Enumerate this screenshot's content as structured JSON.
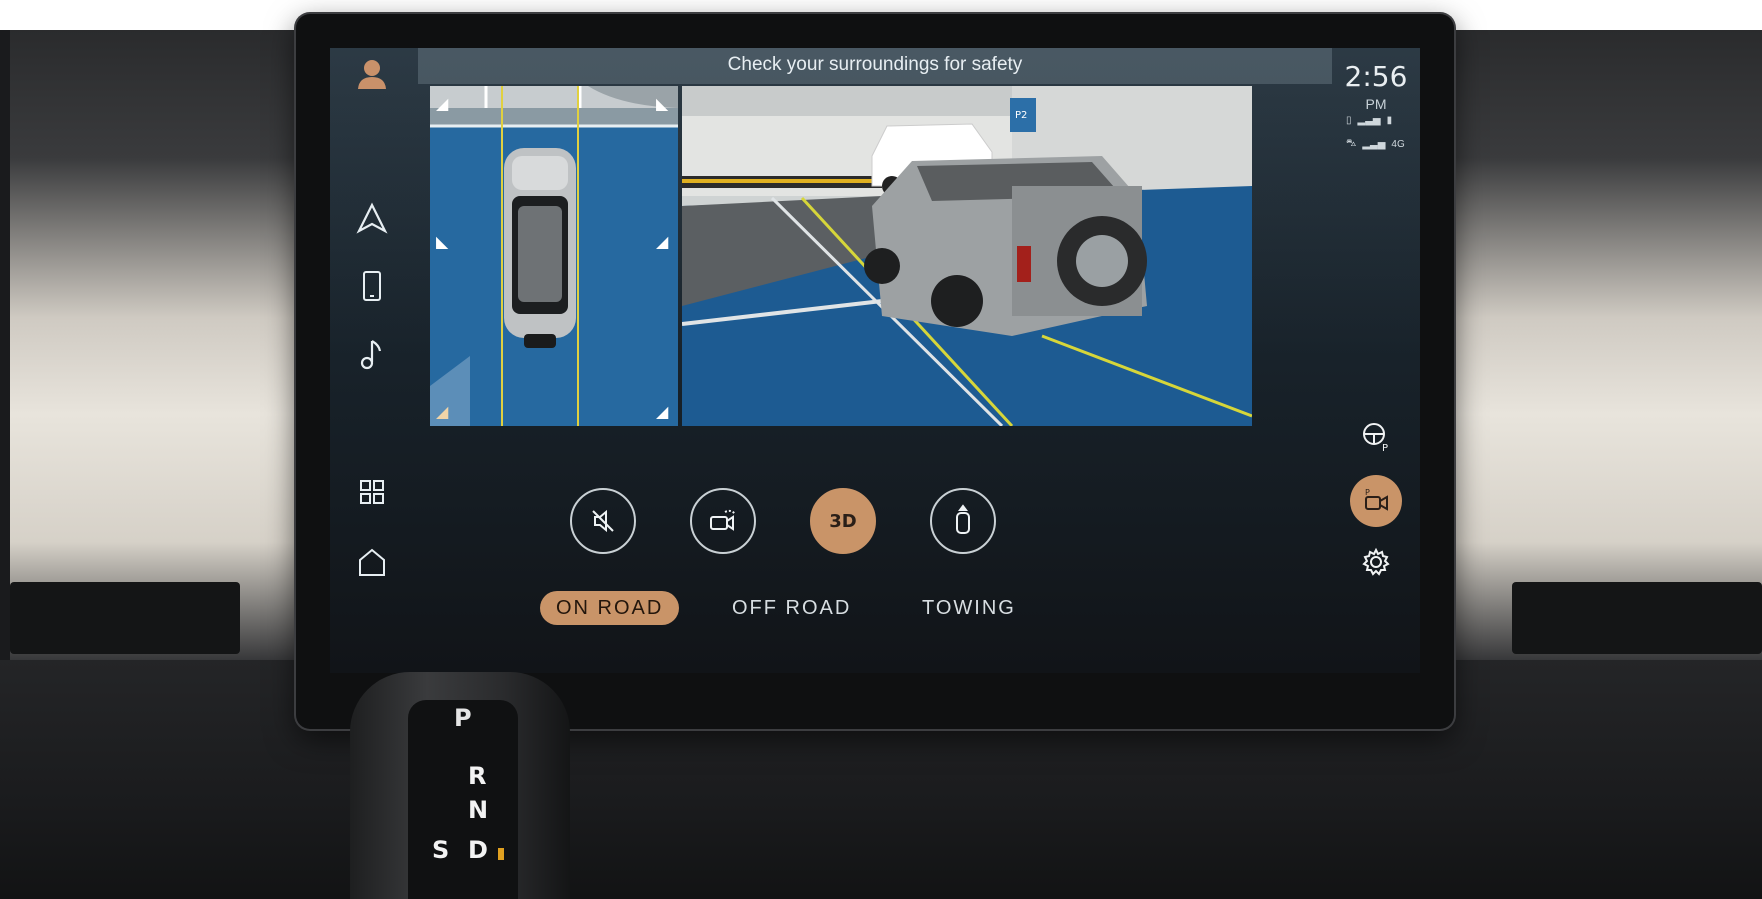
{
  "banner": {
    "text": "Check your surroundings for safety"
  },
  "status": {
    "time": "2:56",
    "ampm": "PM",
    "network": "4G"
  },
  "left_rail": {
    "items": [
      {
        "icon": "user-profile-icon"
      },
      {
        "icon": "navigation-icon"
      },
      {
        "icon": "phone-icon"
      },
      {
        "icon": "music-icon"
      },
      {
        "icon": "apps-grid-icon"
      },
      {
        "icon": "home-icon"
      }
    ]
  },
  "right_rail": {
    "items": [
      {
        "icon": "steering-wheel-parking-icon",
        "active": false
      },
      {
        "icon": "parking-camera-icon",
        "active": true
      },
      {
        "icon": "settings-gear-icon",
        "active": false
      }
    ]
  },
  "camera_controls": [
    {
      "icon": "mute-sensor-audio-icon",
      "label": "",
      "active": false
    },
    {
      "icon": "camera-rotate-view-icon",
      "label": "",
      "active": false
    },
    {
      "icon": "3d-view-icon",
      "label": "3D",
      "active": true
    },
    {
      "icon": "top-view-car-icon",
      "label": "",
      "active": false
    }
  ],
  "modes": [
    {
      "label": "ON ROAD",
      "active": true
    },
    {
      "label": "OFF ROAD",
      "active": false
    },
    {
      "label": "TOWING",
      "active": false
    }
  ],
  "parking_sign": "P2",
  "gear_selector": {
    "park": "P",
    "reverse": "R",
    "neutral": "N",
    "drive": "D",
    "sport": "S"
  },
  "colors": {
    "accent": "#c99468",
    "banner_bg": "#7f949f",
    "ground_blue": "#1f5d8e"
  }
}
